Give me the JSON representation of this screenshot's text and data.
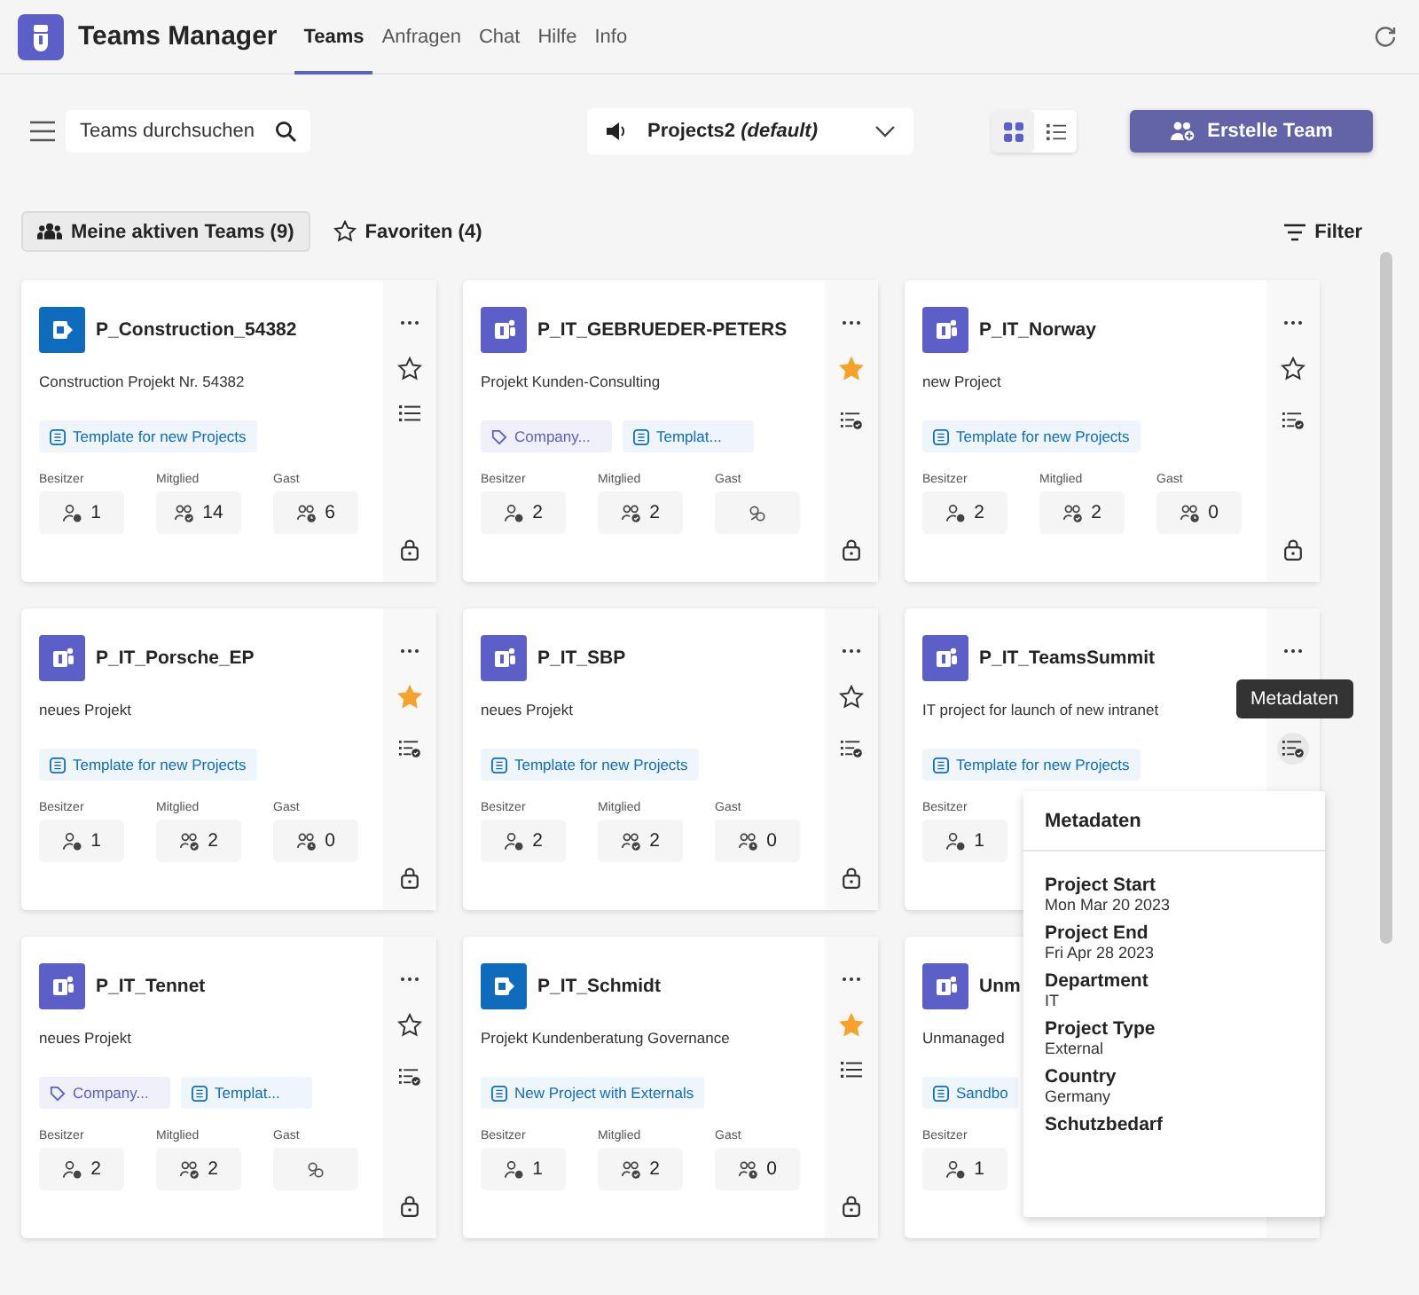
{
  "app": {
    "title": "Teams Manager"
  },
  "nav": [
    {
      "label": "Teams",
      "selected": true
    },
    {
      "label": "Anfragen",
      "selected": false
    },
    {
      "label": "Chat",
      "selected": false
    },
    {
      "label": "Hilfe",
      "selected": false
    },
    {
      "label": "Info",
      "selected": false
    }
  ],
  "search": {
    "placeholder": "Teams durchsuchen"
  },
  "profile_select": {
    "value": "Projects2 *(default)*"
  },
  "view_toggle": [
    {
      "kind": "grid",
      "selected": true
    },
    {
      "kind": "list",
      "selected": false
    }
  ],
  "create_button": {
    "label": "Erstelle Team"
  },
  "filter_tabs": [
    {
      "kind": "teams",
      "label": "Meine aktiven Teams (9)",
      "selected": true
    },
    {
      "kind": "favorites",
      "label": "Favoriten (4)",
      "selected": false
    }
  ],
  "filter_button": {
    "label": "Filter"
  },
  "cards": [
    {
      "kind": "sharepoint",
      "name": "P_Construction_54382",
      "description": "Construction Projekt Nr. 54382",
      "tags": [
        {
          "kind": "template",
          "label": "Template for new Projects"
        }
      ],
      "menu": true,
      "favorite": false,
      "has_metadata": false,
      "private": true,
      "stats": [
        {
          "kind": "owner",
          "label": "Besitzer",
          "value": "1"
        },
        {
          "kind": "member",
          "label": "Mitglied",
          "value": "14"
        },
        {
          "kind": "guest",
          "label": "Gast",
          "value": "6"
        }
      ]
    },
    {
      "kind": "teams",
      "name": "P_IT_GEBRUEDER-PETERS",
      "description": "Projekt Kunden-Consulting",
      "tags": [
        {
          "kind": "label",
          "label": "Company..."
        },
        {
          "kind": "template",
          "label": "Templat..."
        }
      ],
      "menu": true,
      "favorite": true,
      "has_metadata": true,
      "private": true,
      "stats": [
        {
          "kind": "owner",
          "label": "Besitzer",
          "value": "2"
        },
        {
          "kind": "member",
          "label": "Mitglied",
          "value": "2"
        },
        {
          "kind": "guest",
          "label": "Gast"
        }
      ]
    },
    {
      "kind": "teams",
      "name": "P_IT_Norway",
      "description": "new Project",
      "tags": [
        {
          "kind": "template",
          "label": "Template for new Projects"
        }
      ],
      "menu": true,
      "favorite": false,
      "has_metadata": true,
      "private": true,
      "stats": [
        {
          "kind": "owner",
          "label": "Besitzer",
          "value": "2"
        },
        {
          "kind": "member",
          "label": "Mitglied",
          "value": "2"
        },
        {
          "kind": "guest",
          "label": "Gast",
          "value": "0"
        }
      ]
    },
    {
      "kind": "teams",
      "name": "P_IT_Porsche_EP",
      "description": "neues Projekt",
      "tags": [
        {
          "kind": "template",
          "label": "Template for new Projects"
        }
      ],
      "menu": true,
      "favorite": true,
      "has_metadata": true,
      "private": true,
      "stats": [
        {
          "kind": "owner",
          "label": "Besitzer",
          "value": "1"
        },
        {
          "kind": "member",
          "label": "Mitglied",
          "value": "2"
        },
        {
          "kind": "guest",
          "label": "Gast",
          "value": "0"
        }
      ]
    },
    {
      "kind": "teams",
      "name": "P_IT_SBP",
      "description": "neues Projekt",
      "tags": [
        {
          "kind": "template",
          "label": "Template for new Projects"
        }
      ],
      "menu": true,
      "favorite": false,
      "has_metadata": true,
      "private": true,
      "stats": [
        {
          "kind": "owner",
          "label": "Besitzer",
          "value": "2"
        },
        {
          "kind": "member",
          "label": "Mitglied",
          "value": "2"
        },
        {
          "kind": "guest",
          "label": "Gast",
          "value": "0"
        }
      ]
    },
    {
      "kind": "teams",
      "name": "P_IT_TeamsSummit",
      "description": "IT project for launch of new intranet",
      "tags": [
        {
          "kind": "template",
          "label": "Template for new Projects"
        }
      ],
      "menu": true,
      "has_metadata": true,
      "metadata_hovered": true,
      "stats": [
        {
          "kind": "owner",
          "label": "Besitzer",
          "value": "1"
        }
      ]
    },
    {
      "kind": "teams",
      "name": "P_IT_Tennet",
      "description": "neues Projekt",
      "tags": [
        {
          "kind": "label",
          "label": "Company..."
        },
        {
          "kind": "template",
          "label": "Templat..."
        }
      ],
      "menu": true,
      "favorite": false,
      "has_metadata": true,
      "private": true,
      "stats": [
        {
          "kind": "owner",
          "label": "Besitzer",
          "value": "2"
        },
        {
          "kind": "member",
          "label": "Mitglied",
          "value": "2"
        },
        {
          "kind": "guest",
          "label": "Gast"
        }
      ]
    },
    {
      "kind": "sharepoint",
      "name": "P_IT_Schmidt",
      "description": "Projekt Kundenberatung Governance",
      "tags": [
        {
          "kind": "template",
          "label": "New Project with Externals"
        }
      ],
      "menu": true,
      "favorite": true,
      "has_metadata": false,
      "private": true,
      "stats": [
        {
          "kind": "owner",
          "label": "Besitzer",
          "value": "1"
        },
        {
          "kind": "member",
          "label": "Mitglied",
          "value": "2"
        },
        {
          "kind": "guest",
          "label": "Gast",
          "value": "0"
        }
      ]
    },
    {
      "kind": "teams",
      "name": "Unm",
      "description": "Unmanaged",
      "tags": [
        {
          "kind": "template",
          "label": "Sandbo"
        }
      ],
      "stats": [
        {
          "kind": "owner",
          "label": "Besitzer",
          "value": "1"
        }
      ]
    }
  ],
  "tooltip": {
    "text": "Metadaten"
  },
  "metadata_popup": {
    "title": "Metadaten",
    "fields": [
      {
        "label": "Project Start",
        "value": "Mon Mar 20 2023"
      },
      {
        "label": "Project End",
        "value": "Fri Apr 28 2023"
      },
      {
        "label": "Department",
        "value": "IT"
      },
      {
        "label": "Project Type",
        "value": "External"
      },
      {
        "label": "Country",
        "value": "Germany"
      },
      {
        "label": "Schutzbedarf"
      }
    ]
  }
}
